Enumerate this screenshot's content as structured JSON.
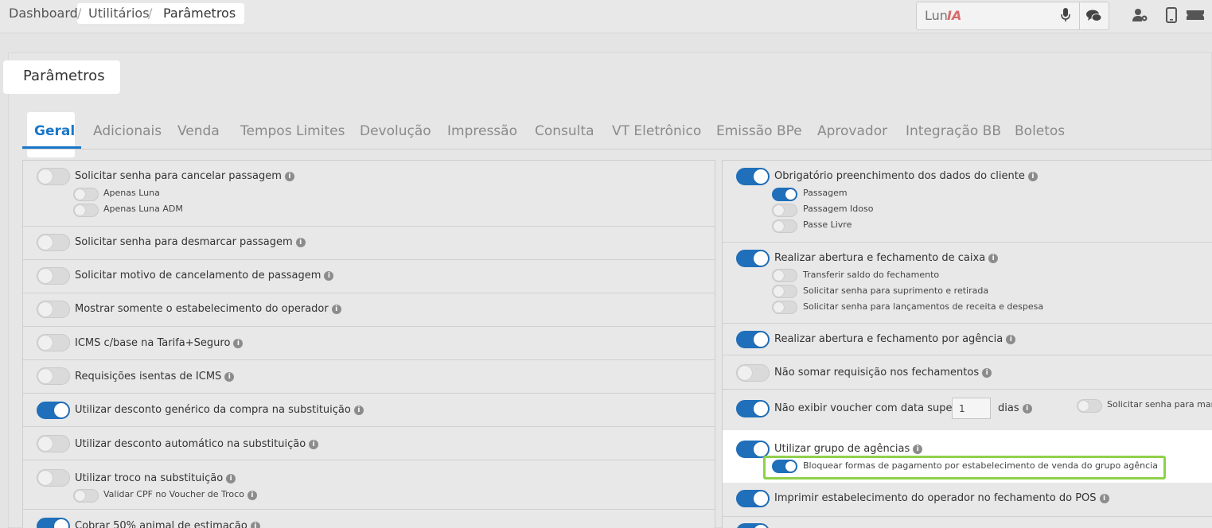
{
  "breadcrumb": {
    "dashboard": "Dashboard",
    "sep1": "/",
    "utilitarios": "Utilitários",
    "sep2": "/",
    "parametros": "Parâmetros"
  },
  "luna": {
    "placeholder": "Lun",
    "ia": "IA"
  },
  "page": {
    "title": "Parâmetros"
  },
  "tabs": [
    {
      "label": "Geral",
      "active": true
    },
    {
      "label": "Adicionais"
    },
    {
      "label": "Venda"
    },
    {
      "label": "Tempos Limites"
    },
    {
      "label": "Devolução"
    },
    {
      "label": "Impressão"
    },
    {
      "label": "Consulta"
    },
    {
      "label": "VT Eletrônico"
    },
    {
      "label": "Emissão BPe"
    },
    {
      "label": "Aprovador"
    },
    {
      "label": "Integração BB"
    },
    {
      "label": "Boletos"
    }
  ],
  "left": {
    "solicitar_senha_cancelar": "Solicitar senha para cancelar passagem",
    "apenas_luna": "Apenas Luna",
    "apenas_luna_adm": "Apenas Luna ADM",
    "solicitar_senha_desmarcar": "Solicitar senha para desmarcar passagem",
    "solicitar_motivo": "Solicitar motivo de cancelamento de passagem",
    "mostrar_estabelecimento": "Mostrar somente o estabelecimento do operador",
    "icms_base": "ICMS c/base na Tarifa+Seguro",
    "requisicoes_icms": "Requisições isentas de ICMS",
    "desconto_generico": "Utilizar desconto genérico da compra na substituição",
    "desconto_automatico": "Utilizar desconto automático na substituição",
    "troco": "Utilizar troco na substituição",
    "validar_cpf": "Validar CPF no Voucher de Troco",
    "cobrar_animal": "Cobrar 50% animal de estimação"
  },
  "right": {
    "obrigatorio_dados": "Obrigatório preenchimento dos dados do cliente",
    "passagem": "Passagem",
    "passagem_idoso": "Passagem Idoso",
    "passe_livre": "Passe Livre",
    "abertura_caixa": "Realizar abertura e fechamento de caixa",
    "transferir_saldo": "Transferir saldo do fechamento",
    "senha_suprimento": "Solicitar senha para suprimento e retirada",
    "senha_lancamentos": "Solicitar senha para lançamentos de receita e despesa",
    "abertura_agencia": "Realizar abertura e fechamento por agência",
    "nao_somar": "Não somar requisição nos fechamentos",
    "nao_exibir_voucher": "Não exibir voucher com data superior a",
    "dias_value": "1",
    "dias": "dias",
    "solicitar_senha_marcar": "Solicitar senha para marca",
    "grupo_agencias": "Utilizar grupo de agências",
    "bloquear_formas": "Bloquear formas de pagamento por estabelecimento de venda do grupo agência",
    "imprimir_estabelecimento": "Imprimir estabelecimento do operador no fechamento do POS"
  },
  "colors": {
    "accent": "#1a76c8",
    "toggle_on": "#1f6fba",
    "highlight": "#8fd14a"
  },
  "icons": [
    "mic-icon",
    "chat-icon",
    "user-settings-icon",
    "mobile-icon",
    "ticket-icon",
    "info-icon"
  ]
}
